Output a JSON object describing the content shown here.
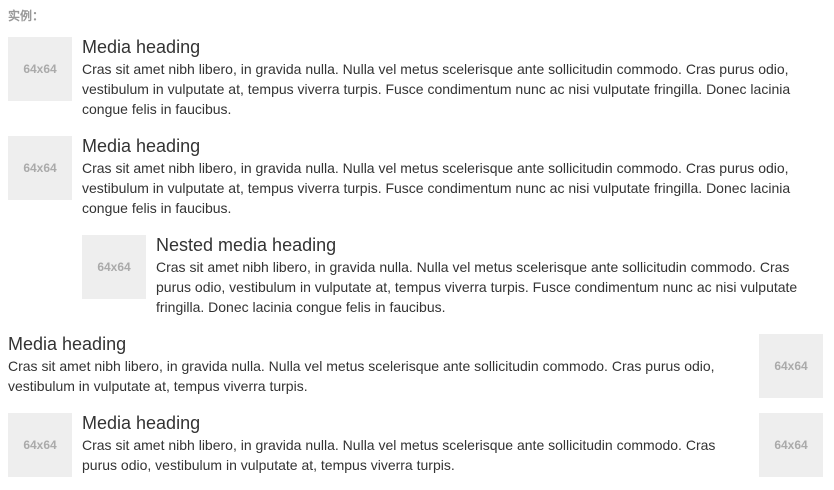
{
  "example_label": "实例：",
  "placeholder": "64x64",
  "items": [
    {
      "heading": "Media heading",
      "text": "Cras sit amet nibh libero, in gravida nulla. Nulla vel metus scelerisque ante sollicitudin commodo. Cras purus odio, vestibulum in vulputate at, tempus viverra turpis. Fusce condimentum nunc ac nisi vulputate fringilla. Donec lacinia congue felis in faucibus."
    },
    {
      "heading": "Media heading",
      "text": "Cras sit amet nibh libero, in gravida nulla. Nulla vel metus scelerisque ante sollicitudin commodo. Cras purus odio, vestibulum in vulputate at, tempus viverra turpis. Fusce condimentum nunc ac nisi vulputate fringilla. Donec lacinia congue felis in faucibus."
    },
    {
      "heading": "Nested media heading",
      "text": "Cras sit amet nibh libero, in gravida nulla. Nulla vel metus scelerisque ante sollicitudin commodo. Cras purus odio, vestibulum in vulputate at, tempus viverra turpis. Fusce condimentum nunc ac nisi vulputate fringilla. Donec lacinia congue felis in faucibus."
    },
    {
      "heading": "Media heading",
      "text": "Cras sit amet nibh libero, in gravida nulla. Nulla vel metus scelerisque ante sollicitudin commodo. Cras purus odio, vestibulum in vulputate at, tempus viverra turpis."
    },
    {
      "heading": "Media heading",
      "text": "Cras sit amet nibh libero, in gravida nulla. Nulla vel metus scelerisque ante sollicitudin commodo. Cras purus odio, vestibulum in vulputate at, tempus viverra turpis."
    }
  ]
}
